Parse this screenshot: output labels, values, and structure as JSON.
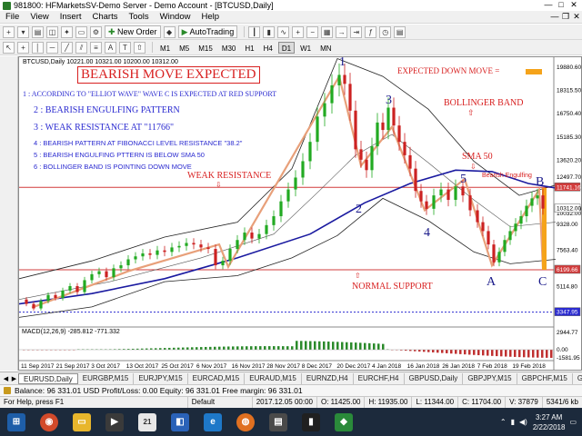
{
  "window": {
    "title": "981800: HFMarketsSV-Demo Server - Demo Account - [BTCUSD,Daily]",
    "controls": [
      "—",
      "□",
      "✕"
    ]
  },
  "menu": {
    "items": [
      "File",
      "View",
      "Insert",
      "Charts",
      "Tools",
      "Window",
      "Help"
    ],
    "right_controls": [
      "—",
      "❐",
      "✕"
    ]
  },
  "toolbar": {
    "new_order": "New Order",
    "autotrading": "AutoTrading",
    "timeframes": [
      "M1",
      "M5",
      "M15",
      "M30",
      "H1",
      "H4",
      "D1",
      "W1",
      "MN"
    ],
    "active_timeframe": "D1"
  },
  "chart": {
    "symbol_header": "BTCUSD,Daily  10221.00 10321.00 10200.00 10312.00",
    "title_box": "BEARISH MOVE EXPECTED",
    "notes": [
      "1 : ACCORDING TO \"ELLIOT WAVE\" WAVE C IS EXPECTED AT RED SUPPORT",
      "2 : BEARISH ENGULFING PATTERN",
      "3 : WEAK RESISTANCE  AT \"11766\"",
      "4 : BEARISH PATTERN AT FIBONACCI LEVEL RESISTANCE \"38.2\"",
      "5 : BEARISH ENGULFING PTTERN IS BELOW SMA 50",
      "6 : BOLLINGER BAND IS POINTING DOWN MOVE"
    ],
    "expected_label": "EXPECTED DOWN MOVE =",
    "bollinger_label": "BOLLINGER BAND",
    "sma_label": "SMA 50",
    "engulfing_label": "Bearish Engulfing",
    "weak_resistance_label": "WEAK RESISTANCE",
    "normal_support_label": "NORMAL SUPPORT",
    "wave_labels": [
      "1",
      "2",
      "3",
      "4",
      "5",
      "A",
      "B",
      "C"
    ],
    "price_axis": [
      "19880.60",
      "18315.50",
      "16750.40",
      "15185.30",
      "13620.20",
      "12497.70",
      "11741.16",
      "10312.00",
      "10032.00",
      "9328.00",
      "7563.40",
      "6199.66",
      "5114.80",
      "3347.95"
    ],
    "highlight_prices": {
      "resistance": "11741.16",
      "current": "10312.00",
      "support": "6199.66",
      "lower": "3347.95"
    },
    "macd_header": "MACD(12,26,9) -285.812 -771.332",
    "macd_axis": [
      "2944.77",
      "0.00",
      "-1581.95"
    ],
    "date_axis": [
      "11 Sep 2017",
      "21 Sep 2017",
      "3 Oct 2017",
      "13 Oct 2017",
      "25 Oct 2017",
      "6 Nov 2017",
      "16 Nov 2017",
      "28 Nov 2017",
      "8 Dec 2017",
      "20 Dec 2017",
      "4 Jan 2018",
      "16 Jan 2018",
      "26 Jan 2018",
      "7 Feb 2018",
      "19 Feb 2018"
    ],
    "colors": {
      "resistance_line": "#d23c3c",
      "support_line": "#d23c3c",
      "sma": "#1a1aa0",
      "bollinger": "#222222",
      "wave": "#e8a07a",
      "bull": "#22aa22",
      "bear": "#cc2222",
      "note_blue": "#2a2ad0",
      "ann_red": "#d82020",
      "down_arrow": "#f5a31a"
    }
  },
  "tabs": {
    "items": [
      "EURUSD,Daily",
      "EURGBP,M15",
      "EURJPY,M15",
      "EURCAD,M15",
      "EURAUD,M15",
      "EURNZD,H4",
      "EURCHF,H4",
      "GBPUSD,Daily",
      "GBPJPY,M15",
      "GBPCHF,M15",
      "GBPCA"
    ],
    "active": "EURUSD,Daily"
  },
  "balance": {
    "text": "Balance: 96 331.01 USD  Profit/Loss: 0.00  Equity: 96 331.01  Free margin: 96 331.01"
  },
  "status": {
    "help": "For Help, press F1",
    "profile": "Default",
    "datetime": "2017.12.05 00:00",
    "open": "O: 11425.00",
    "high": "H: 11935.00",
    "low": "L: 11344.00",
    "close": "C: 11704.00",
    "volume": "V: 37879",
    "traffic": "5341/6 kb"
  },
  "taskbar": {
    "time": "3:27 AM",
    "date": "2/22/2018"
  }
}
